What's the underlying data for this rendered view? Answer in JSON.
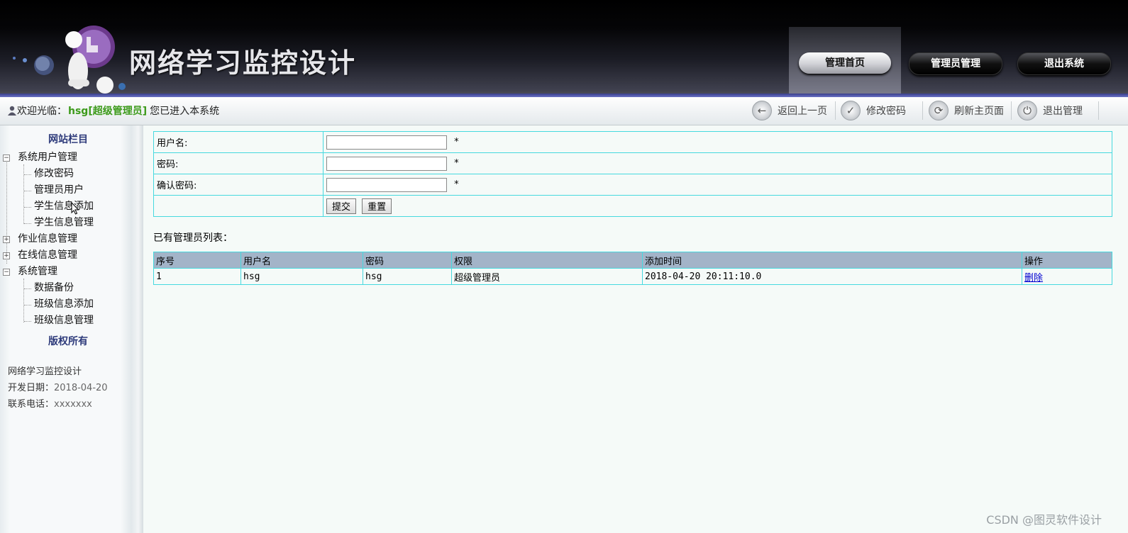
{
  "header": {
    "site_title": "网络学习监控设计",
    "nav": [
      {
        "label": "管理首页",
        "active": true
      },
      {
        "label": "管理员管理",
        "active": false
      },
      {
        "label": "退出系统",
        "active": false
      }
    ]
  },
  "welcome_bar": {
    "prefix": "欢迎光临：",
    "user": "hsg[超级管理员]",
    "suffix": "您已进入本系统",
    "tools": [
      {
        "icon": "back-arrow-icon",
        "label": "返回上一页"
      },
      {
        "icon": "password-check-icon",
        "label": "修改密码"
      },
      {
        "icon": "refresh-icon",
        "label": "刷新主页面"
      },
      {
        "icon": "power-icon",
        "label": "退出管理"
      }
    ]
  },
  "sidebar": {
    "title": "网站栏目",
    "groups": [
      {
        "label": "系统用户管理",
        "expanded": true,
        "items": [
          "修改密码",
          "管理员用户",
          "学生信息添加",
          "学生信息管理"
        ]
      },
      {
        "label": "作业信息管理",
        "expanded": false,
        "items": []
      },
      {
        "label": "在线信息管理",
        "expanded": false,
        "items": []
      },
      {
        "label": "系统管理",
        "expanded": true,
        "items": [
          "数据备份",
          "班级信息添加",
          "班级信息管理"
        ]
      }
    ],
    "copyright_title": "版权所有",
    "info": {
      "name": "网络学习监控设计",
      "date_label": "开发日期：",
      "date_value": "2018-04-20",
      "phone_label": "联系电话：",
      "phone_value": "xxxxxxx"
    }
  },
  "form": {
    "username_label": "用户名:",
    "password_label": "密码:",
    "confirm_label": "确认密码:",
    "username_value": "",
    "password_value": "",
    "confirm_value": "",
    "required_mark": "*",
    "submit_label": "提交",
    "reset_label": "重置"
  },
  "list": {
    "title": "已有管理员列表：",
    "headers": [
      "序号",
      "用户名",
      "密码",
      "权限",
      "添加时间",
      "操作"
    ],
    "rows": [
      {
        "no": "1",
        "username": "hsg",
        "password": "hsg",
        "role": "超级管理员",
        "added": "2018-04-20 20:11:10.0",
        "action": "删除"
      }
    ]
  },
  "watermark": "CSDN @图灵软件设计",
  "colors": {
    "accent_green": "#3c9a1a",
    "table_border": "#46d9df",
    "header_row": "#a3b4c8",
    "link": "#0000d0"
  }
}
